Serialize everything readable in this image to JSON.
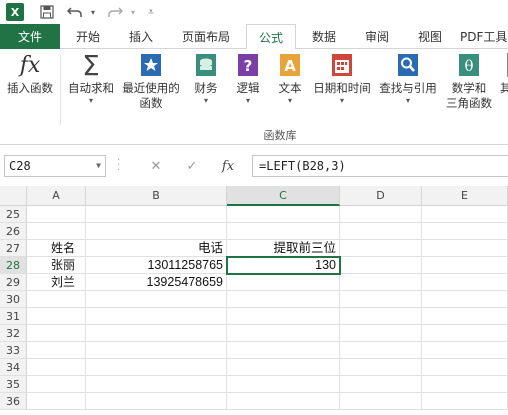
{
  "quick_access": {
    "logo": "X",
    "save_icon": "save-icon",
    "undo_icon": "undo-icon",
    "redo_icon": "redo-icon"
  },
  "tabs": [
    {
      "label": "文件"
    },
    {
      "label": "开始"
    },
    {
      "label": "插入"
    },
    {
      "label": "页面布局"
    },
    {
      "label": "公式"
    },
    {
      "label": "数据"
    },
    {
      "label": "审阅"
    },
    {
      "label": "视图"
    },
    {
      "label": "PDF工具"
    }
  ],
  "active_tab": "公式",
  "ribbon": {
    "buttons": [
      {
        "label": "插入函数",
        "icon": "fx-icon"
      },
      {
        "label": "自动求和",
        "icon": "sigma-icon",
        "caret": "▾"
      },
      {
        "label": "最近使用的\n函数",
        "icon": "star-icon",
        "caret": "▾"
      },
      {
        "label": "财务",
        "icon": "coins-icon",
        "caret": "▾"
      },
      {
        "label": "逻辑",
        "icon": "question-icon",
        "caret": "▾"
      },
      {
        "label": "文本",
        "icon": "text-a-icon",
        "caret": "▾"
      },
      {
        "label": "日期和时间",
        "icon": "calendar-icon",
        "caret": "▾"
      },
      {
        "label": "查找与引用",
        "icon": "lookup-icon",
        "caret": "▾"
      },
      {
        "label": "数学和\n三角函数",
        "icon": "theta-icon",
        "caret": "▾"
      },
      {
        "label": "其",
        "icon": "more-icon"
      }
    ],
    "group_label": "函数库"
  },
  "formula_bar": {
    "name_box": "C28",
    "cancel_symbol": "✕",
    "enter_symbol": "✓",
    "fx_symbol": "fx",
    "formula": "=LEFT(B28,3)"
  },
  "sheet": {
    "columns": [
      "A",
      "B",
      "C",
      "D",
      "E"
    ],
    "rows": [
      {
        "num": "25",
        "a": "",
        "b": "",
        "c": ""
      },
      {
        "num": "26",
        "a": "",
        "b": "",
        "c": ""
      },
      {
        "num": "27",
        "a": "姓名",
        "b": "电话",
        "c": "提取前三位"
      },
      {
        "num": "28",
        "a": "张丽",
        "b": "13011258765",
        "c": "130"
      },
      {
        "num": "29",
        "a": "刘兰",
        "b": "13925478659",
        "c": ""
      },
      {
        "num": "30",
        "a": "",
        "b": "",
        "c": ""
      },
      {
        "num": "31",
        "a": "",
        "b": "",
        "c": ""
      },
      {
        "num": "32",
        "a": "",
        "b": "",
        "c": ""
      },
      {
        "num": "33",
        "a": "",
        "b": "",
        "c": ""
      },
      {
        "num": "34",
        "a": "",
        "b": "",
        "c": ""
      },
      {
        "num": "35",
        "a": "",
        "b": "",
        "c": ""
      },
      {
        "num": "36",
        "a": "",
        "b": "",
        "c": ""
      }
    ],
    "selected_cell": "C28"
  },
  "colors": {
    "accent": "#217346",
    "header_bg": "#f2f2f2",
    "grid_line": "#e0e0e0"
  }
}
